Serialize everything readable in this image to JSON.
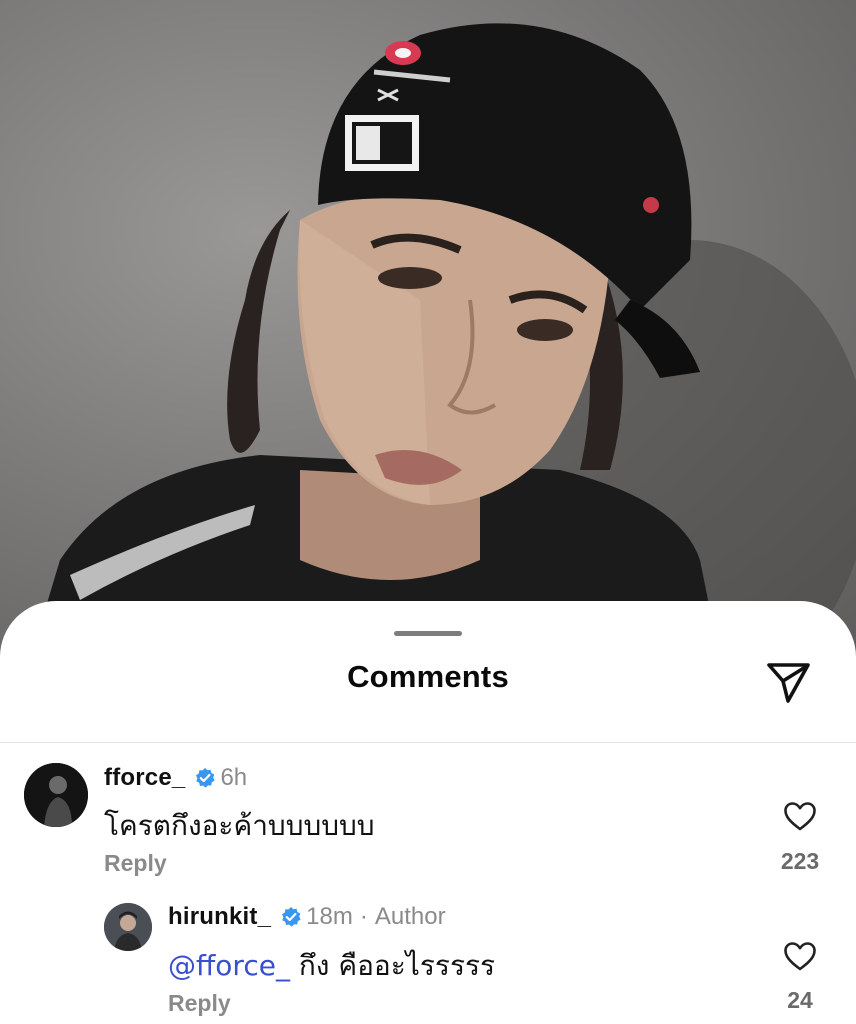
{
  "sheet": {
    "title": "Comments"
  },
  "comments": [
    {
      "username": "fforce_",
      "time": "6h",
      "text": "โครตกึงอะค้าบบบบบบ",
      "reply_label": "Reply",
      "likes": "223"
    }
  ],
  "replies": [
    {
      "username": "hirunkit_",
      "time": "18m",
      "separator": "·",
      "badge": "Author",
      "mention": "@fforce_",
      "text": " กึง คืออะไรรรรร",
      "reply_label": "Reply",
      "likes": "24"
    }
  ],
  "colors": {
    "verified": "#3897f0",
    "mention": "#3a4fd0",
    "muted": "#8a8a8a"
  },
  "icons": {
    "share": "paper-plane-icon",
    "like": "heart-outline-icon",
    "verified": "verified-badge-icon"
  }
}
